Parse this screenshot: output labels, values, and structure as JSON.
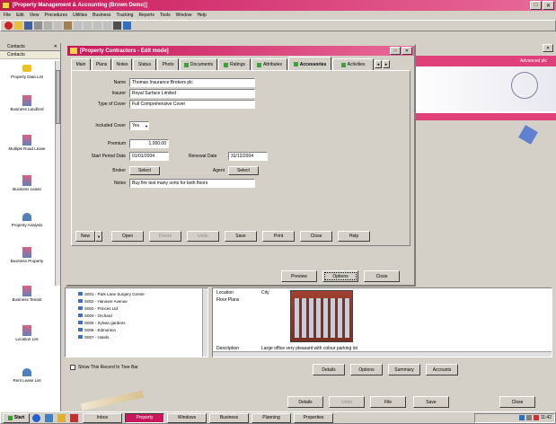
{
  "app": {
    "title": "[Property Management & Accounting (Brown Demo)]",
    "menu": [
      "File",
      "Edit",
      "View",
      "Procedures",
      "Utilities",
      "Business",
      "Tracking",
      "Reports",
      "Tools",
      "Window",
      "Help"
    ]
  },
  "leftpanel": {
    "header": "Contacts",
    "tab": "Contacts",
    "items": [
      {
        "label": "Property Data List"
      },
      {
        "label": "Business Landlord"
      },
      {
        "label": "Multiple Road Lease"
      },
      {
        "label": "Business Lease"
      },
      {
        "label": "Property Analysis"
      },
      {
        "label": "Business Property"
      },
      {
        "label": "Business Tenant"
      },
      {
        "label": "Location List"
      },
      {
        "label": "Rent Lease List"
      }
    ]
  },
  "dialog": {
    "title": "[Property Contractors - Edit mode]",
    "tabs": [
      "Main",
      "Plans",
      "Notes",
      "Status",
      "Photo",
      "Documents",
      "Ratings",
      "Attributes",
      "Accessories",
      "Activities"
    ],
    "form": {
      "name_label": "Name",
      "name_value": "Thomas Insurance Brokers plc",
      "insurer_label": "Insurer",
      "insurer_value": "Royal Surface Limited",
      "type_label": "Type of Cover",
      "type_value": "Full Comprehensive Cover",
      "included_label": "Included Cover",
      "included_value": "Yes",
      "premium_label": "Premium",
      "premium_value": "1,000.00",
      "start_label": "Start Period Date",
      "start_value": "01/01/2004",
      "renewal_label": "Renewal Date",
      "renewal_value": "31/12/2004",
      "broker_label": "Broker",
      "broker_btn": "Select",
      "agent_label": "Agent",
      "agent_btn": "Select",
      "notes_label": "Notes",
      "notes_value": "Buy fire test many sorts for both floors"
    },
    "bottom_buttons": [
      "New",
      "Open",
      "Delete",
      "Undo",
      "Save",
      "Print",
      "Close",
      "Help"
    ],
    "footer_buttons": [
      "Preview",
      "Options",
      "Close"
    ]
  },
  "banner": {
    "right_text": "Advanced plc"
  },
  "tree": {
    "items": [
      "S001 - Park Lane Surgery Centre",
      "S002 - Hanover Avenue",
      "S003 - Princes Ltd",
      "S004 - Orchard",
      "S005 - Sylvan gardens",
      "S006 - Edmonton",
      "S007 - Hotels"
    ]
  },
  "detail": {
    "rows": [
      {
        "k": "Location",
        "v": "City"
      },
      {
        "k": "Floor Plans",
        "v": ""
      }
    ],
    "description_label": "Description",
    "description_value": "Large office very pleasant with colour parking lot"
  },
  "checkbox_label": "Show This Record In Tree Bar",
  "action_buttons": [
    "Details",
    "Options",
    "Summary",
    "Accounts"
  ],
  "lower_buttons": [
    "Details",
    "Undo",
    "File",
    "Save",
    "Close"
  ],
  "taskbar": {
    "start": "Start",
    "tasks": [
      "Inbox",
      "Property",
      "Windows",
      "Business",
      "Planning",
      "Properties"
    ],
    "clock": "11:42"
  },
  "colors": {
    "title_bar": "#c8185a",
    "dialog_title": "#c8185a",
    "banner": "#e0407a",
    "desktop": "#d4d0c8"
  }
}
